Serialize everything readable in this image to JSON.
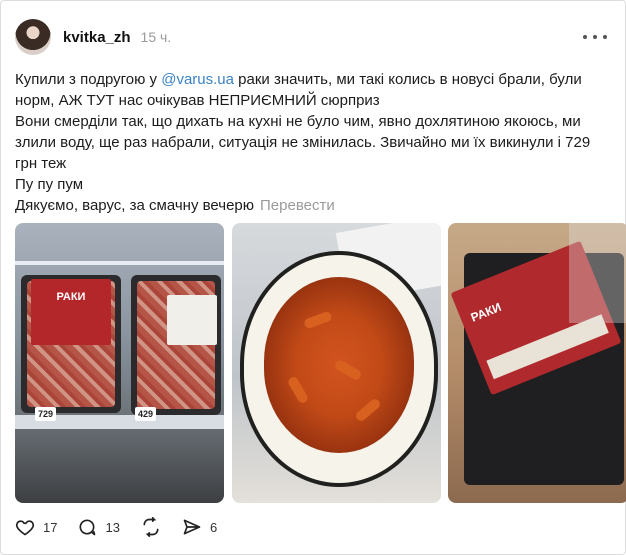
{
  "post": {
    "username": "kvitka_zh",
    "time": "15 ч.",
    "text": {
      "line1_before": "Купили з подругою у ",
      "mention": "@varus.ua",
      "line1_after": " раки значить, ми такі колись в новусі брали, були норм, АЖ ТУТ нас очікував НЕПРИЄМНИЙ сюрприз",
      "line2": "Вони смерділи так, що дихать на кухні не було чим, явно дохлятиною якоюсь, ми злили воду, ще раз набрали, ситуація не змінилась. Звичайно ми їх викинули і 729 грн теж",
      "line3": "Пу пу пум",
      "line4": "Дякуємо, варус, за смачну вечерю",
      "translate": "Перевести"
    },
    "photos": {
      "photo1": {
        "pack_label": "РАКИ",
        "price_left": "729",
        "price_right": "429"
      },
      "photo3": {
        "pack_label": "РАКИ"
      }
    },
    "actions": {
      "likes": "17",
      "comments": "13",
      "shares": "6"
    }
  },
  "colors": {
    "mention": "#3b82c4",
    "muted": "#9a9a9a",
    "text": "#1c1c1c"
  },
  "icons": [
    "more-icon",
    "heart-icon",
    "comment-icon",
    "repost-icon",
    "share-icon"
  ]
}
